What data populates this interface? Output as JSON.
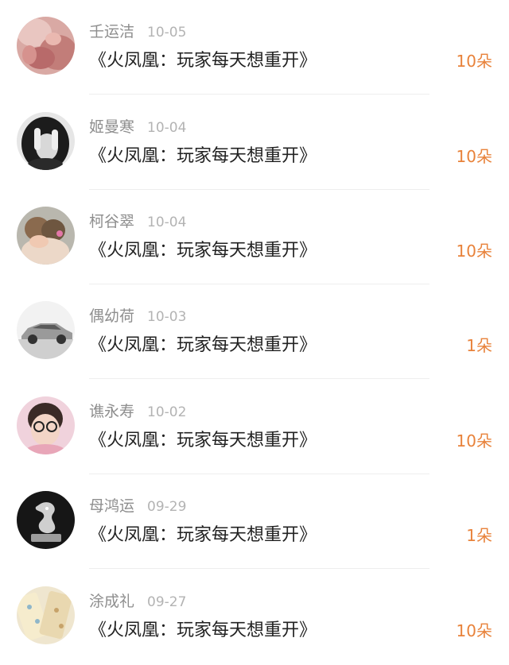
{
  "colors": {
    "gift_accent": "#e8823a",
    "name_text": "#8e8e8e",
    "date_text": "#b3b3b3",
    "title_text": "#222222"
  },
  "rows": [
    {
      "user": "壬运洁",
      "date": "10-05",
      "title": "《火凤凰：玩家每天想重开》",
      "gift": "10朵",
      "avatar_icon": "baby-photo-avatar"
    },
    {
      "user": "姬曼寒",
      "date": "10-04",
      "title": "《火凤凰：玩家每天想重开》",
      "gift": "10朵",
      "avatar_icon": "bw-girl-photo-avatar"
    },
    {
      "user": "柯谷翠",
      "date": "10-04",
      "title": "《火凤凰：玩家每天想重开》",
      "gift": "10朵",
      "avatar_icon": "kids-hug-photo-avatar"
    },
    {
      "user": "偶幼荷",
      "date": "10-03",
      "title": "《火凤凰：玩家每天想重开》",
      "gift": "1朵",
      "avatar_icon": "car-photo-avatar"
    },
    {
      "user": "谯永寿",
      "date": "10-02",
      "title": "《火凤凰：玩家每天想重开》",
      "gift": "10朵",
      "avatar_icon": "girl-glasses-photo-avatar"
    },
    {
      "user": "母鸿运",
      "date": "09-29",
      "title": "《火凤凰：玩家每天想重开》",
      "gift": "1朵",
      "avatar_icon": "dragon-statue-photo-avatar"
    },
    {
      "user": "涂成礼",
      "date": "09-27",
      "title": "《火凤凰：玩家每天想重开》",
      "gift": "10朵",
      "avatar_icon": "fabric-photo-avatar"
    }
  ]
}
